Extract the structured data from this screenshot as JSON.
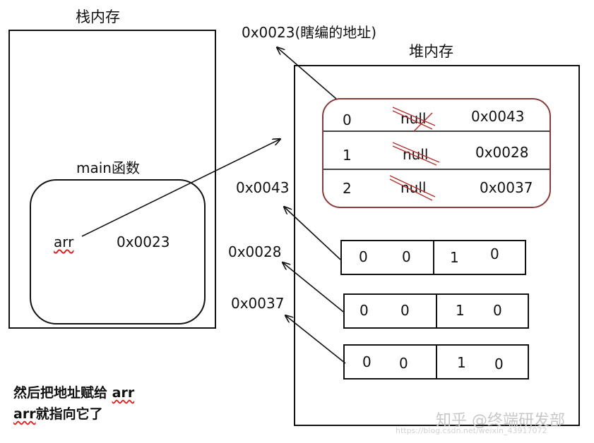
{
  "stack": {
    "title": "栈内存",
    "func_label": "main函数",
    "var_name": "arr",
    "var_value": "0x0023"
  },
  "heap": {
    "title": "堆内存",
    "fake_addr_label": "0x0023(瞎编的地址)",
    "array_rows": [
      {
        "index": "0",
        "value": "null",
        "ref": "0x0043"
      },
      {
        "index": "1",
        "value": "null",
        "ref": "0x0028"
      },
      {
        "index": "2",
        "value": "null",
        "ref": "0x0037"
      }
    ],
    "sub_arrays": [
      {
        "addr": "0x0043",
        "cells": [
          "0",
          "0",
          "1",
          "0"
        ]
      },
      {
        "addr": "0x0028",
        "cells": [
          "0",
          "0",
          "1",
          "0"
        ]
      },
      {
        "addr": "0x0037",
        "cells": [
          "0",
          "0",
          "1",
          "0"
        ]
      }
    ]
  },
  "notes": {
    "line1_pre": "然后把地址赋给 ",
    "line1_var": "arr",
    "line2_var": "arr",
    "line2_post": "就指向它了"
  },
  "watermark": {
    "main": "知乎 @终端研发部",
    "url": "https://blog.csdn.net/weixin_43917072"
  },
  "colors": {
    "object_border": "#8a3a3a",
    "strike": "#b03030"
  }
}
